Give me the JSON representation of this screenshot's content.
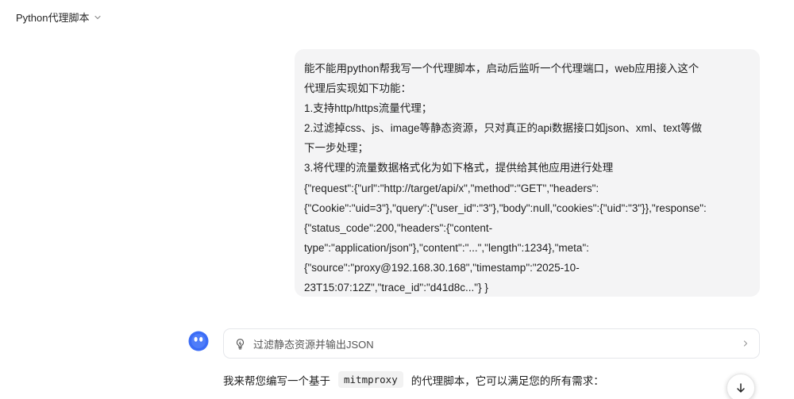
{
  "header": {
    "title": "Python代理脚本"
  },
  "user_message": {
    "lines": [
      "能不能用python帮我写一个代理脚本，启动后监听一个代理端口，web应用接入这个",
      "代理后实现如下功能：",
      "1.支持http/https流量代理；",
      "2.过滤掉css、js、image等静态资源，只对真正的api数据接口如json、xml、text等做",
      "下一步处理；",
      "3.将代理的流量数据格式化为如下格式，提供给其他应用进行处理",
      "{\"request\":{\"url\":\"http://target/api/x\",\"method\":\"GET\",\"headers\":",
      "{\"Cookie\":\"uid=3\"},\"query\":{\"user_id\":\"3\"},\"body\":null,\"cookies\":{\"uid\":\"3\"}},\"response\":",
      "{\"status_code\":200,\"headers\":{\"content-",
      "type\":\"application/json\"},\"content\":\"...\",\"length\":1234},\"meta\":",
      "{\"source\":\"proxy@192.168.30.168\",\"timestamp\":\"2025-10-",
      "23T15:07:12Z\",\"trace_id\":\"d41d8c...\"} }"
    ]
  },
  "assistant": {
    "thinking_label": "过滤静态资源并输出JSON",
    "reply_prefix": "我来帮您编写一个基于",
    "reply_code": "mitmproxy",
    "reply_suffix": "的代理脚本，它可以满足您的所有需求："
  },
  "icons": {
    "title_chevron": "chevron-down-icon",
    "avatar": "assistant-avatar-icon",
    "thinking": "lightbulb-icon",
    "expand": "chevron-right-icon",
    "scroll": "arrow-down-icon"
  },
  "colors": {
    "bubble_bg": "#f4f4f5",
    "avatar_blue": "#3b6cf6",
    "border": "#e5e7eb"
  }
}
